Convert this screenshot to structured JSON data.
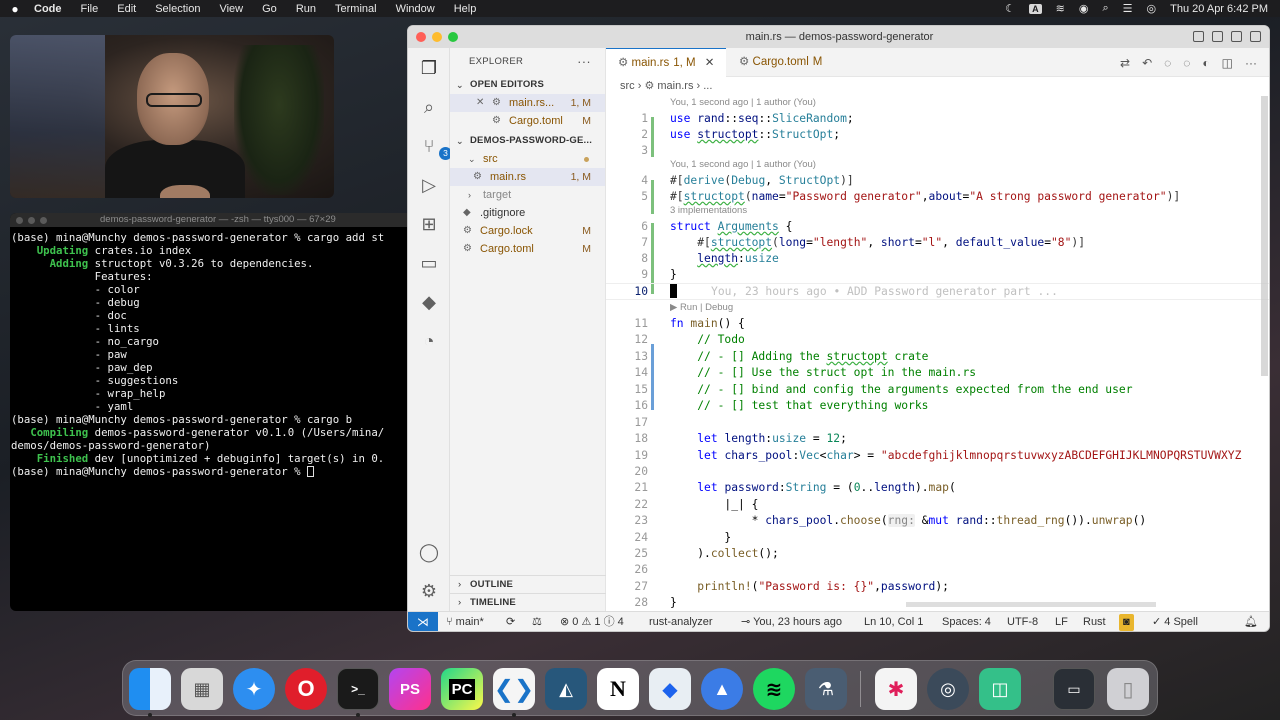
{
  "menubar": {
    "app": "Code",
    "items": [
      "File",
      "Edit",
      "Selection",
      "View",
      "Go",
      "Run",
      "Terminal",
      "Window",
      "Help"
    ],
    "input_badge": "A",
    "clock": "Thu 20 Apr  6:42 PM"
  },
  "terminal": {
    "title": "demos-password-generator — -zsh — ttys000 — 67×29",
    "lines": [
      {
        "pre": "",
        "hl": "",
        "text": "(base) mina@Munchy demos-password-generator % cargo add st"
      },
      {
        "pre": "    ",
        "hl": "Updating",
        "text": " crates.io index"
      },
      {
        "pre": "      ",
        "hl": "Adding",
        "text": " structopt v0.3.26 to dependencies."
      },
      {
        "pre": "",
        "hl": "",
        "text": "             Features:"
      },
      {
        "pre": "",
        "hl": "",
        "text": "             - color"
      },
      {
        "pre": "",
        "hl": "",
        "text": "             - debug"
      },
      {
        "pre": "",
        "hl": "",
        "text": "             - doc"
      },
      {
        "pre": "",
        "hl": "",
        "text": "             - lints"
      },
      {
        "pre": "",
        "hl": "",
        "text": "             - no_cargo"
      },
      {
        "pre": "",
        "hl": "",
        "text": "             - paw"
      },
      {
        "pre": "",
        "hl": "",
        "text": "             - paw_dep"
      },
      {
        "pre": "",
        "hl": "",
        "text": "             - suggestions"
      },
      {
        "pre": "",
        "hl": "",
        "text": "             - wrap_help"
      },
      {
        "pre": "",
        "hl": "",
        "text": "             - yaml"
      },
      {
        "pre": "",
        "hl": "",
        "text": "(base) mina@Munchy demos-password-generator % cargo b"
      },
      {
        "pre": "   ",
        "hl": "Compiling",
        "text": " demos-password-generator v0.1.0 (/Users/mina/"
      },
      {
        "pre": "",
        "hl": "",
        "text": "demos/demos-password-generator)"
      },
      {
        "pre": "    ",
        "hl": "Finished",
        "text": " dev [unoptimized + debuginfo] target(s) in 0."
      },
      {
        "pre": "",
        "hl": "",
        "text": "(base) mina@Munchy demos-password-generator % "
      }
    ]
  },
  "vscode": {
    "title": "main.rs — demos-password-generator",
    "sidebar": {
      "header": "EXPLORER",
      "open_editors_label": "OPEN EDITORS",
      "open_editors": [
        {
          "name": "main.rs...",
          "status": "1, M"
        },
        {
          "name": "Cargo.toml",
          "status": "M"
        }
      ],
      "project_label": "DEMOS-PASSWORD-GE...",
      "tree": [
        {
          "name": "src",
          "status": ""
        },
        {
          "name": "main.rs",
          "status": "1, M"
        },
        {
          "name": "target",
          "status": ""
        },
        {
          "name": ".gitignore",
          "status": ""
        },
        {
          "name": "Cargo.lock",
          "status": "M"
        },
        {
          "name": "Cargo.toml",
          "status": "M"
        }
      ],
      "outline_label": "OUTLINE",
      "timeline_label": "TIMELINE"
    },
    "tabs": [
      {
        "name": "main.rs",
        "status": "1, M"
      },
      {
        "name": "Cargo.toml",
        "status": "M"
      }
    ],
    "breadcrumb": [
      "src",
      "main.rs",
      "..."
    ],
    "lenses": {
      "blame1": "You, 1 second ago | 1 author (You)",
      "blame2": "You, 1 second ago | 1 author (You)",
      "impls": "3 implementations",
      "run": "▶ Run | Debug"
    },
    "ghost_blame": "You, 23 hours ago • ADD Password generator part ...",
    "line_numbers": [
      "1",
      "2",
      "3",
      "4",
      "5",
      "6",
      "7",
      "8",
      "9",
      "10",
      "11",
      "12",
      "13",
      "14",
      "15",
      "16",
      "17",
      "18",
      "19",
      "20",
      "21",
      "22",
      "23",
      "24",
      "25",
      "26",
      "27",
      "28"
    ],
    "statusbar": {
      "branch": "main*",
      "problems": "0",
      "warnings": "1",
      "info": "4",
      "analyzer": "rust-analyzer",
      "blame": "You, 23 hours ago",
      "position": "Ln 10, Col 1",
      "spaces": "Spaces: 4",
      "encoding": "UTF-8",
      "eol": "LF",
      "language": "Rust",
      "spell": "4 Spell"
    }
  },
  "dock": {
    "apps": [
      "finder-icon",
      "launchpad-icon",
      "safari-icon",
      "opera-icon",
      "terminal-icon",
      "phpstorm-icon",
      "pycharm-icon",
      "vscode-icon",
      "mysql-workbench-icon",
      "notion-icon",
      "docker-icon",
      "vpn-icon",
      "spotify-icon",
      "lab-icon",
      "slack-icon",
      "quicktime-icon",
      "sketch-icon",
      "screen-icon",
      "trash-icon"
    ],
    "labels": {
      "phpstorm": "PS",
      "pycharm": "PC",
      "notion": "N",
      "terminal": ">_"
    }
  }
}
